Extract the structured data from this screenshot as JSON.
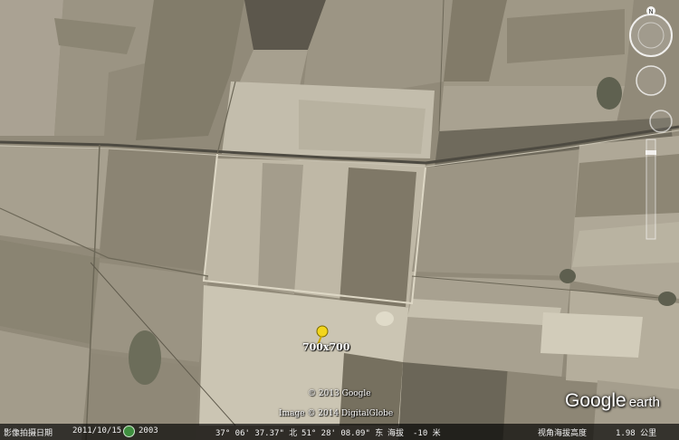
{
  "map": {
    "placemark_label": "700x700",
    "copyright_google": "© 2013 Google",
    "copyright_image": "Image © 2014 DigitalGlobe",
    "logo_google": "Google",
    "logo_earth": "earth",
    "compass_north": "N"
  },
  "status_bar": {
    "imagery_date_label": "影像拍摄日期",
    "imagery_date": "2011/10/15",
    "history_year": "2003",
    "latitude": "37° 06' 37.37\" 北",
    "longitude": "51° 28' 08.09\" 东",
    "elevation_label": "海拔",
    "elevation": "-10 米",
    "eye_alt_label": "视角海拔高度",
    "eye_alt": "1.98 公里"
  },
  "colors": {
    "status_bar_bg": "#000000",
    "placemark": "#f2d51c",
    "overlay_text": "#ffffff"
  },
  "icons": {
    "placemark": "yellow-pushpin-icon",
    "history": "clock-icon",
    "compass": "compass-icon",
    "look": "look-joystick-icon",
    "move": "move-joystick-icon",
    "zoom": "zoom-slider-icon"
  }
}
